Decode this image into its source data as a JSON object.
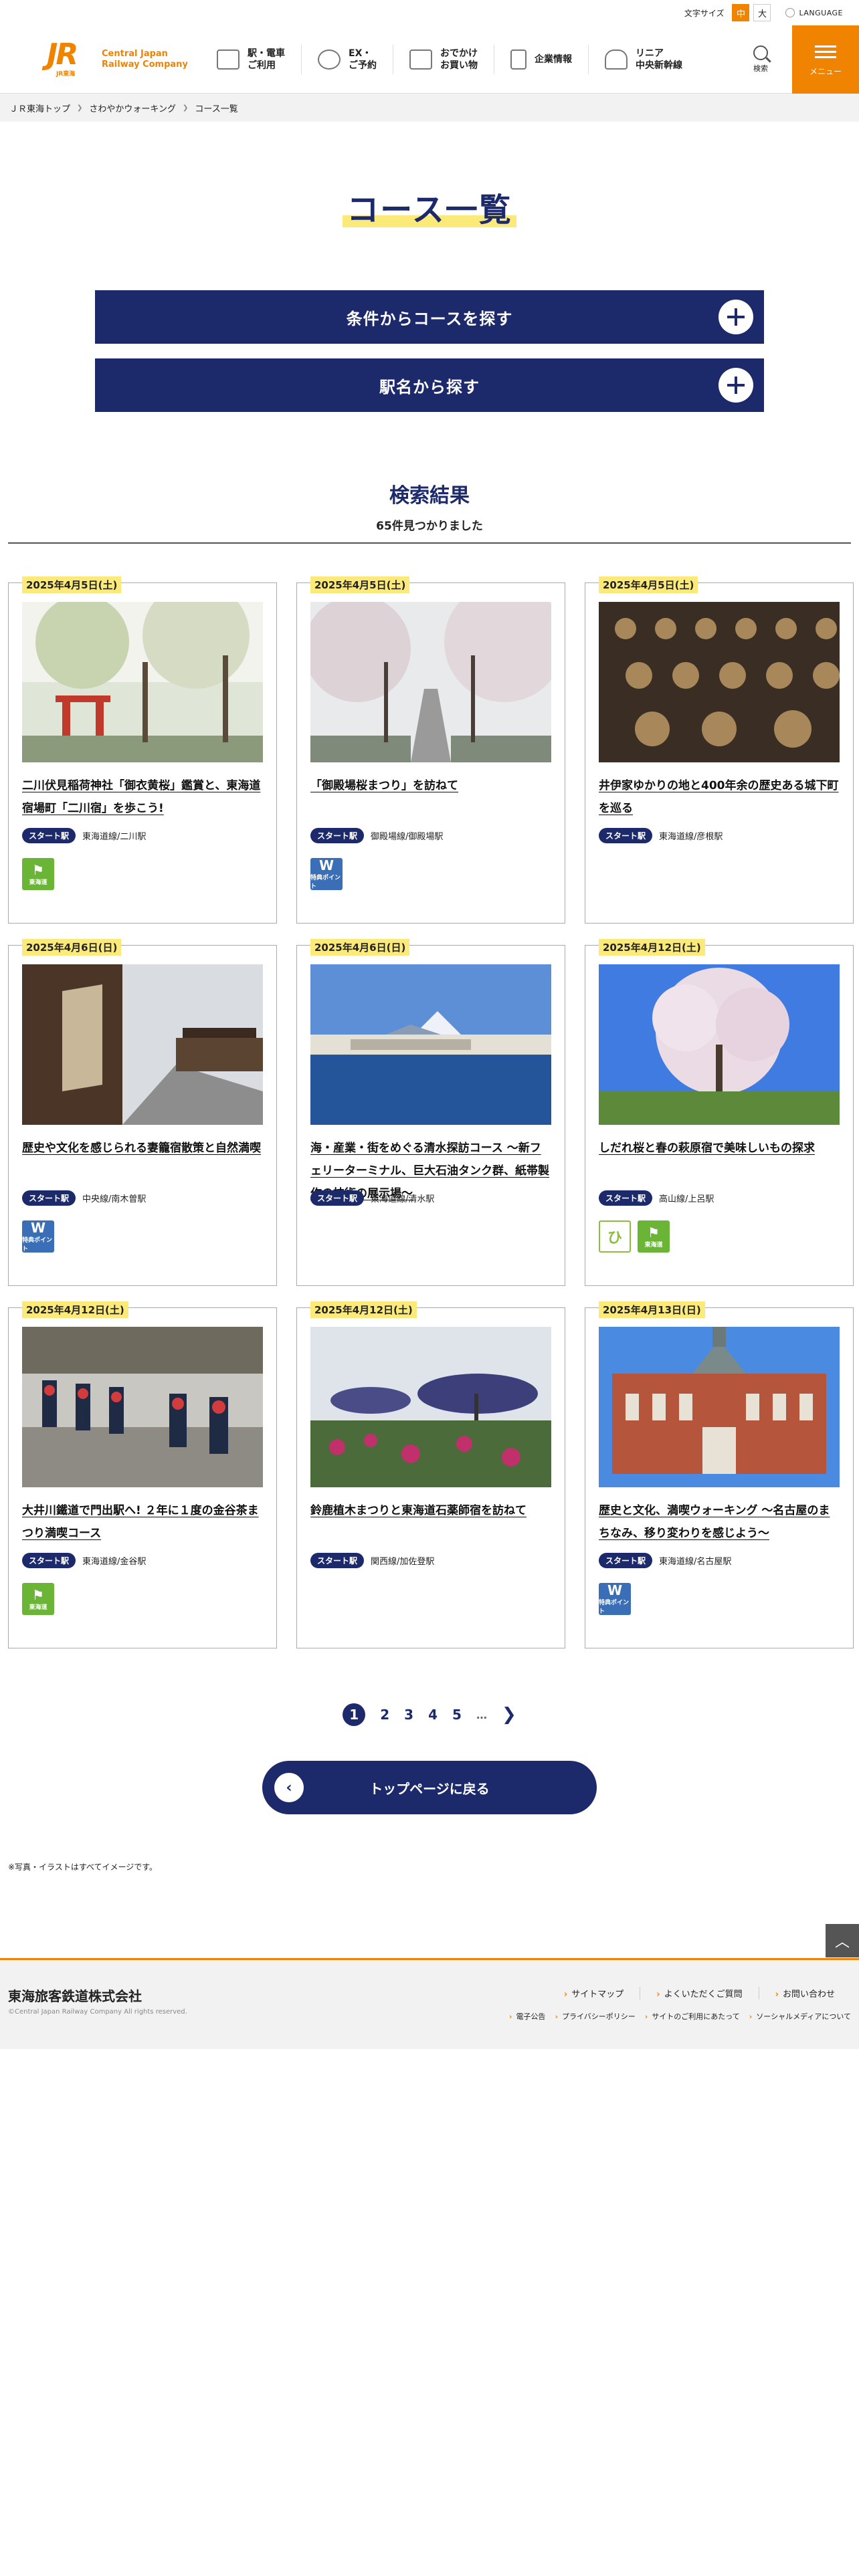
{
  "utility": {
    "font_size_label": "文字サイズ",
    "font_medium": "中",
    "font_large": "大",
    "language": "LANGUAGE"
  },
  "header": {
    "logo_sub": "JR東海",
    "logo_text_1": "Central Japan",
    "logo_text_2": "Railway Company",
    "nav": [
      {
        "line1": "駅・電車",
        "line2": "ご利用",
        "icon": "train-icon"
      },
      {
        "line1": "EX・",
        "line2": "ご予約",
        "icon": "ticket-icon"
      },
      {
        "line1": "おでかけ",
        "line2": "お買い物",
        "icon": "building-icon"
      },
      {
        "line1": "企業情報",
        "line2": "",
        "icon": "document-icon"
      },
      {
        "line1": "リニア",
        "line2": "中央新幹線",
        "icon": "maglev-icon"
      }
    ],
    "search_label": "検索",
    "menu_label": "メニュー"
  },
  "breadcrumb": [
    "ＪＲ東海トップ",
    "さわやかウォーキング",
    "コース一覧"
  ],
  "title": "コース一覧",
  "accordions": [
    "条件からコースを探す",
    "駅名から探す"
  ],
  "results": {
    "title": "検索結果",
    "count": "65件見つかりました"
  },
  "start_badge": "スタート駅",
  "courses": [
    {
      "date": "2025年4月5日(土)",
      "title": "二川伏見稲荷神社「御衣黄桜」鑑賞と、東海道宿場町「二川宿」を歩こう!",
      "station": "東海道線/二川駅",
      "tags": [
        "green"
      ]
    },
    {
      "date": "2025年4月5日(土)",
      "title": "「御殿場桜まつり」を訪ねて",
      "station": "御殿場線/御殿場駅",
      "tags": [
        "blue"
      ]
    },
    {
      "date": "2025年4月5日(土)",
      "title": "井伊家ゆかりの地と400年余の歴史ある城下町を巡る",
      "station": "東海道線/彦根駅",
      "tags": []
    },
    {
      "date": "2025年4月6日(日)",
      "title": "歴史や文化を感じられる妻籠宿散策と自然満喫",
      "station": "中央線/南木曽駅",
      "tags": [
        "blue"
      ]
    },
    {
      "date": "2025年4月6日(日)",
      "title": "海・産業・街をめぐる清水探訪コース 〜新フェリーターミナル、巨大石油タンク群、紙帯製作の技術の展示場〜",
      "station": "東海道線/清水駅",
      "tags": []
    },
    {
      "date": "2025年4月12日(土)",
      "title": "しだれ桜と春の萩原宿で美味しいもの探求",
      "station": "高山線/上呂駅",
      "tags": [
        "hi",
        "green"
      ]
    },
    {
      "date": "2025年4月12日(土)",
      "title": "大井川鐵道で門出駅へ! ２年に１度の金谷茶まつり満喫コース",
      "station": "東海道線/金谷駅",
      "tags": [
        "green"
      ]
    },
    {
      "date": "2025年4月12日(土)",
      "title": "鈴鹿植木まつりと東海道石薬師宿を訪ねて",
      "station": "関西線/加佐登駅",
      "tags": []
    },
    {
      "date": "2025年4月13日(日)",
      "title": "歴史と文化、満喫ウォーキング 〜名古屋のまちなみ、移り変わりを感じよう〜",
      "station": "東海道線/名古屋駅",
      "tags": [
        "blue"
      ]
    }
  ],
  "tag_labels": {
    "green_glyph": "⚑",
    "green": "東海道",
    "blue_glyph": "W",
    "blue": "特典ポイント",
    "hi": "ひ"
  },
  "pager": {
    "pages": [
      "1",
      "2",
      "3",
      "4",
      "5"
    ],
    "ellipsis": "…",
    "next": "❯"
  },
  "back_label": "トップページに戻る",
  "note": "※写真・イラストはすべてイメージです。",
  "footer": {
    "company": "東海旅客鉄道株式会社",
    "copyright": "©Central Japan Railway Company All rights reserved.",
    "links": [
      "サイトマップ",
      "よくいただくご質問",
      "お問い合わせ"
    ],
    "sub_links": [
      "電子公告",
      "プライバシーポリシー",
      "サイトのご利用にあたって",
      "ソーシャルメディアについて"
    ]
  },
  "colors": {
    "accent": "#f08300",
    "navy": "#1c2a6b",
    "highlight": "#fbe97a"
  }
}
